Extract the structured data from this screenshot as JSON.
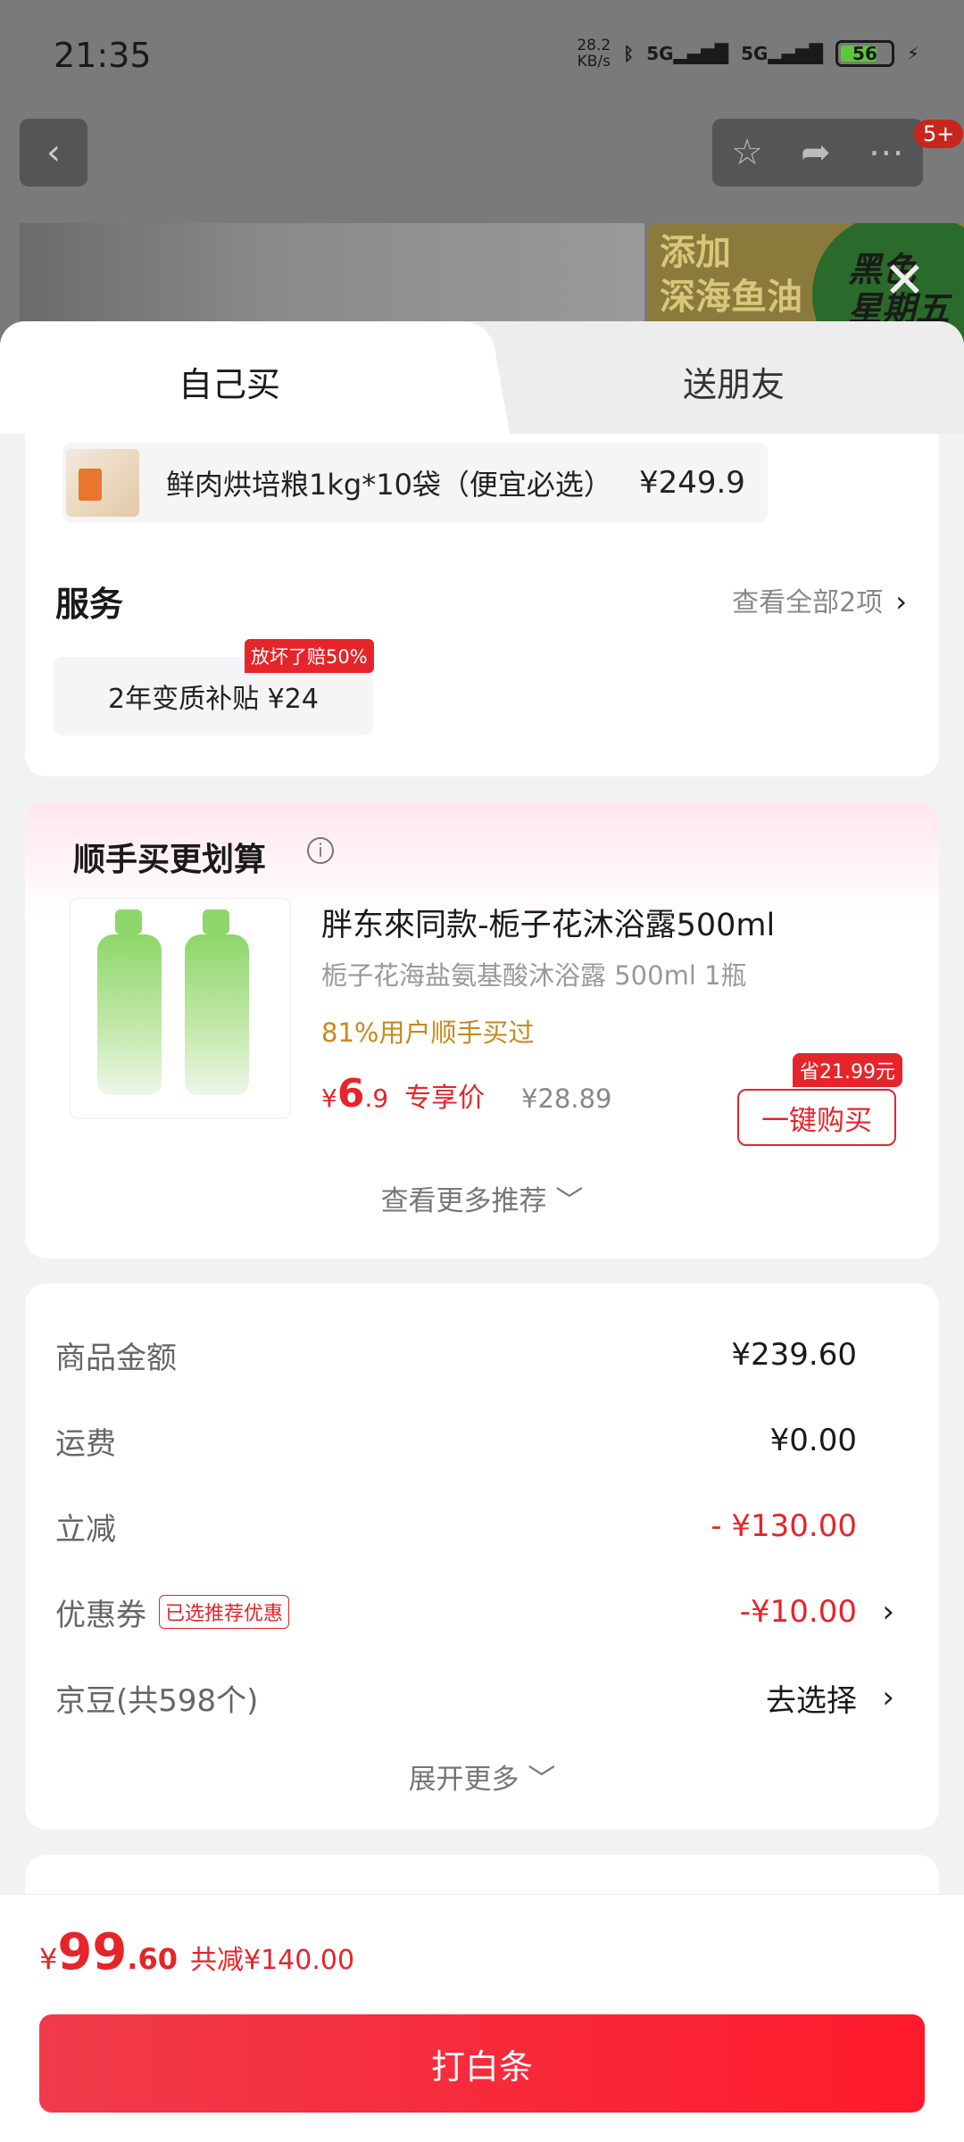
{
  "status_bar": {
    "time": "21:35",
    "net_speed_value": "28.2",
    "net_speed_unit": "KB/s",
    "signal1": "5G",
    "signal2": "5G",
    "battery": "56"
  },
  "top": {
    "back_icon": "chevron-left-icon",
    "msg_count": "5+"
  },
  "banner": {
    "promo_text_line1": "添加",
    "promo_text_line2": "深海鱼油",
    "badge_line1": "黑色",
    "badge_line2": "星期五"
  },
  "tabs": [
    {
      "label": "自己买"
    },
    {
      "label": "送朋友"
    }
  ],
  "selected_product": {
    "name": "鲜肉烘培粮1kg*10袋（便宜必选）",
    "price": "¥249.9"
  },
  "service": {
    "title": "服务",
    "view_all": "查看全部2项",
    "chip_label": "2年变质补贴  ¥24",
    "chip_badge": "放坏了赔50%"
  },
  "upsell": {
    "title": "顺手买更划算",
    "name": "胖东來同款-栀子花沐浴露500ml",
    "desc": "栀子花海盐氨基酸沐浴露 500ml 1瓶",
    "bought": "81%用户顺手买过",
    "price_yen": "¥",
    "price_int": "6",
    "price_dec": ".9",
    "price_tag": "专享价",
    "orig_price": "¥28.89",
    "save_badge": "省21.99元",
    "buy_label": "一键购买",
    "more": "查看更多推荐 ﹀"
  },
  "summary": {
    "items": [
      {
        "label": "商品金额",
        "value": "¥239.60"
      },
      {
        "label": "运费",
        "value": "¥0.00"
      },
      {
        "label": "立减",
        "value": "- ¥130.00"
      },
      {
        "label": "优惠券",
        "badge": "已选推荐优惠",
        "value": "-¥10.00"
      },
      {
        "label": "京豆(共598个)",
        "value": "去选择"
      }
    ],
    "expand": "展开更多 ﹀"
  },
  "footer": {
    "yen": "¥",
    "total_int": "99",
    "total_dec": ".60",
    "saved": "共减¥140.00",
    "pay_label": "打白条"
  },
  "colors": {
    "accent": "#e5252a",
    "bought": "#c8891a"
  }
}
